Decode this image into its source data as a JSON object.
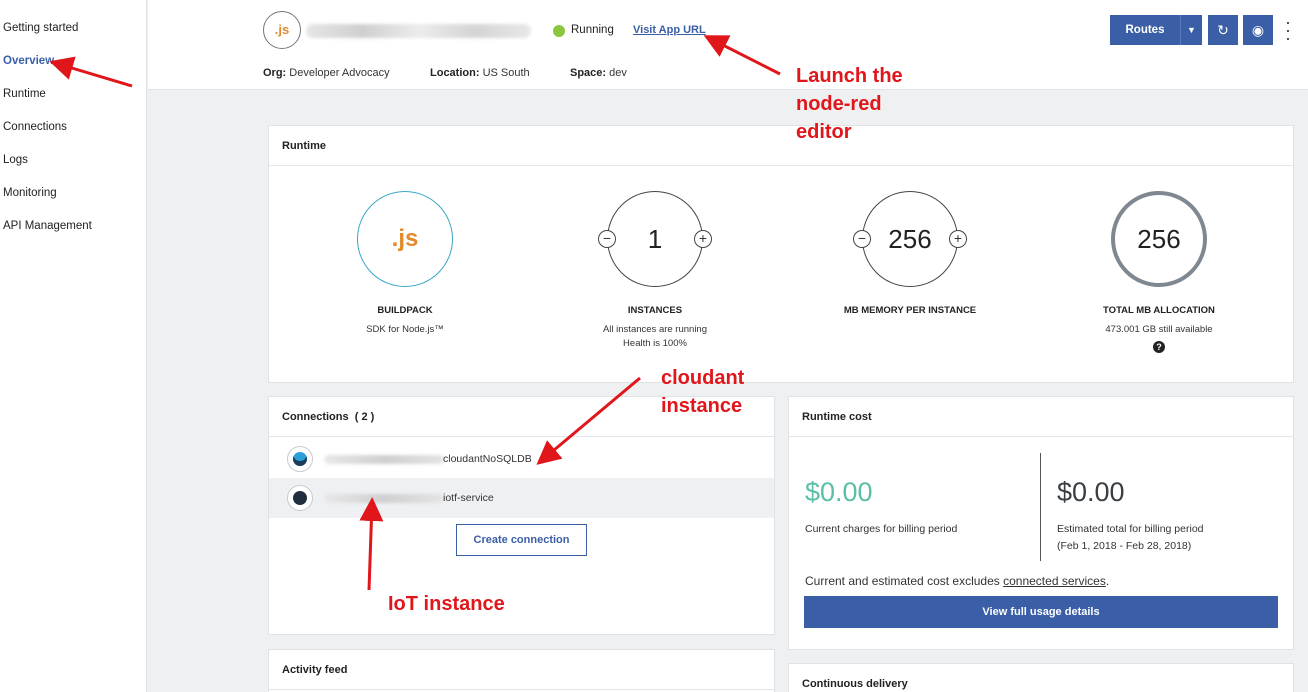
{
  "sidebar": {
    "items": [
      {
        "label": "Getting started"
      },
      {
        "label": "Overview"
      },
      {
        "label": "Runtime"
      },
      {
        "label": "Connections"
      },
      {
        "label": "Logs"
      },
      {
        "label": "Monitoring"
      },
      {
        "label": "API Management"
      }
    ]
  },
  "header": {
    "app_icon": ".js",
    "status": "Running",
    "status_color": "#8cc63f",
    "visit_link": "Visit App URL",
    "org_label": "Org:",
    "org_value": "Developer Advocacy",
    "location_label": "Location:",
    "location_value": "US South",
    "space_label": "Space:",
    "space_value": "dev",
    "routes_label": "Routes",
    "restart_icon": "restart-icon",
    "stop_icon": "stop-icon"
  },
  "runtime": {
    "title": "Runtime",
    "buildpack": {
      "icon": ".js",
      "label": "BUILDPACK",
      "sub": "SDK for Node.js™"
    },
    "instances": {
      "value": "1",
      "label": "INSTANCES",
      "sub1": "All instances are running",
      "sub2": "Health is 100%"
    },
    "memory": {
      "value": "256",
      "label": "MB MEMORY PER INSTANCE"
    },
    "total": {
      "value": "256",
      "label": "TOTAL MB ALLOCATION",
      "sub": "473.001 GB still available",
      "help": "?"
    }
  },
  "connections": {
    "title": "Connections",
    "count": "( 2 )",
    "items": [
      {
        "name": "cloudantNoSQLDB",
        "icon": "cloudant-icon"
      },
      {
        "name": "iotf-service",
        "icon": "iot-icon"
      }
    ],
    "create_label": "Create connection"
  },
  "cost": {
    "title": "Runtime cost",
    "current_value": "$0.00",
    "current_label": "Current charges for billing period",
    "current_color": "#5bbfa8",
    "estimated_value": "$0.00",
    "estimated_label": "Estimated total for billing period",
    "estimated_range": "(Feb 1, 2018 - Feb 28, 2018)",
    "note_prefix": "Current and estimated cost excludes ",
    "note_link": "connected services",
    "note_suffix": ".",
    "usage_button": "View full usage details"
  },
  "activity": {
    "title": "Activity feed"
  },
  "delivery": {
    "title": "Continuous delivery"
  },
  "annotations": {
    "launch": "Launch the\nnode-red\neditor",
    "cloudant": "cloudant\ninstance",
    "iot": "IoT instance"
  },
  "colors": {
    "accent": "#3a5fa6",
    "annotation": "#e0161b"
  }
}
